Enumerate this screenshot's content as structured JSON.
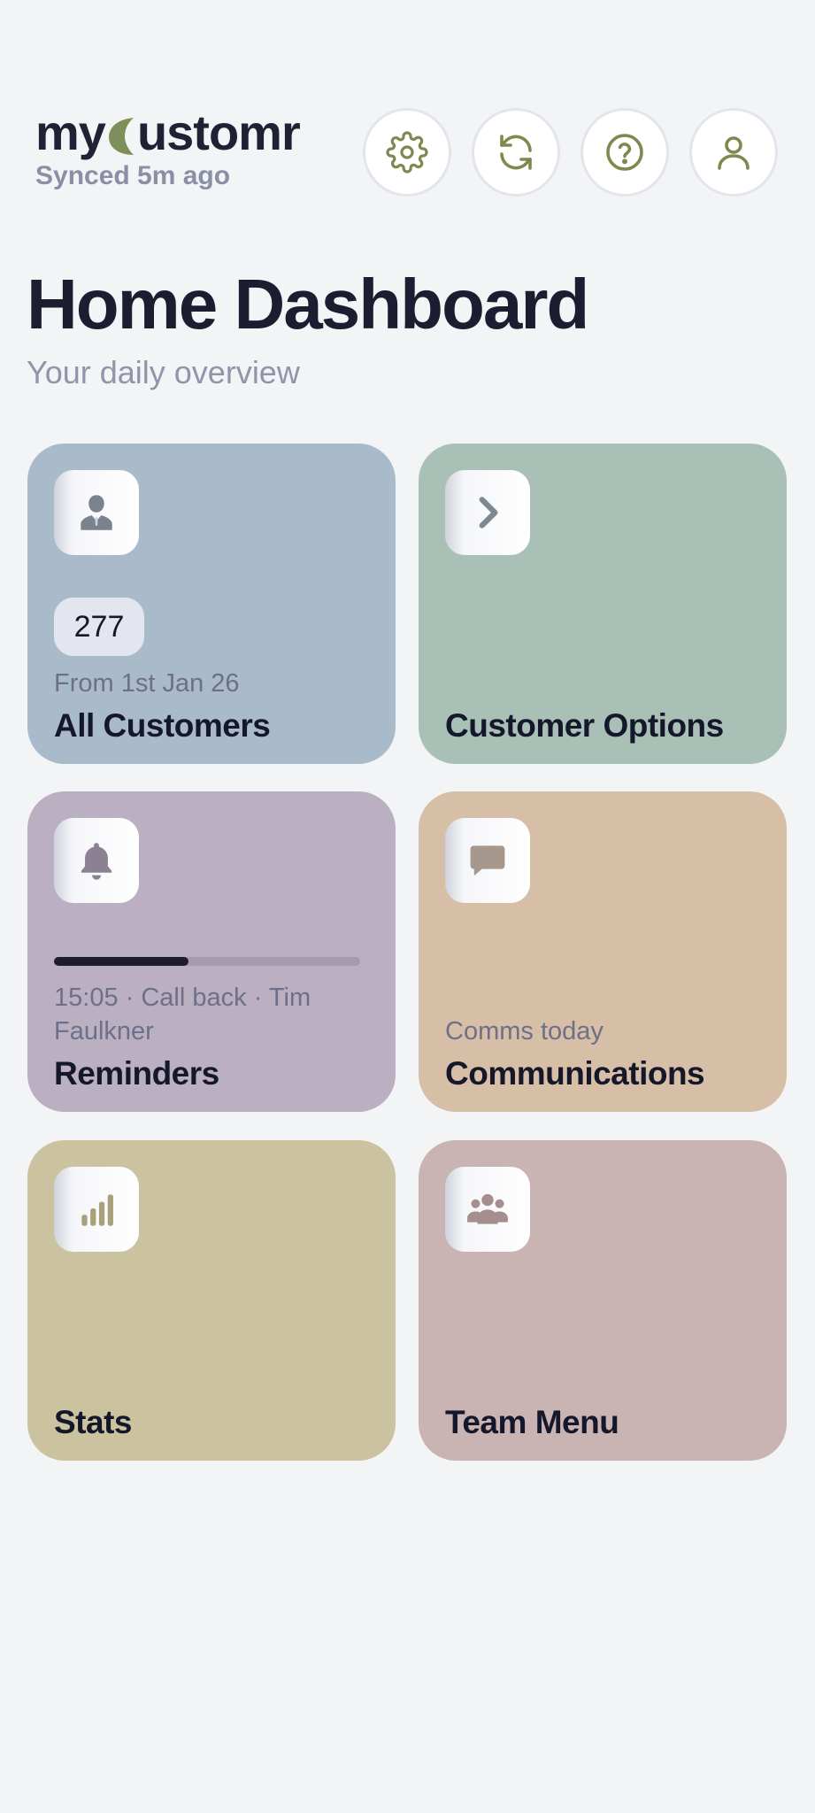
{
  "app": {
    "logo_prefix": "my",
    "logo_suffix": "ustomr",
    "sync_status": "Synced 5m ago"
  },
  "header_icons": [
    {
      "name": "settings-icon"
    },
    {
      "name": "refresh-icon"
    },
    {
      "name": "help-icon"
    },
    {
      "name": "user-icon"
    }
  ],
  "page": {
    "title": "Home Dashboard",
    "subtitle": "Your daily overview"
  },
  "tiles": {
    "customers": {
      "title": "All Customers",
      "count": "277",
      "subtitle": "From 1st Jan 26",
      "color": "#a9bacb",
      "icon": "customer-icon"
    },
    "customer_options": {
      "title": "Customer Options",
      "color": "#a8c0b6",
      "icon": "chevron-right-icon"
    },
    "reminders": {
      "title": "Reminders",
      "subtitle": "15:05 · Call back · Tim Faulkner",
      "progress": 0.44,
      "color": "#bbafc2",
      "icon": "bell-icon"
    },
    "communications": {
      "title": "Communications",
      "subtitle": "Comms today",
      "color": "#d7bea6",
      "icon": "chat-icon"
    },
    "stats": {
      "title": "Stats",
      "color": "#cbc29f",
      "icon": "bar-chart-icon"
    },
    "team_menu": {
      "title": "Team Menu",
      "color": "#c9b4b3",
      "icon": "team-icon"
    }
  },
  "colors": {
    "background": "#f3f4f6",
    "accent_leaf": "#7d8f5a",
    "icon_olive": "#7d8a4e"
  }
}
